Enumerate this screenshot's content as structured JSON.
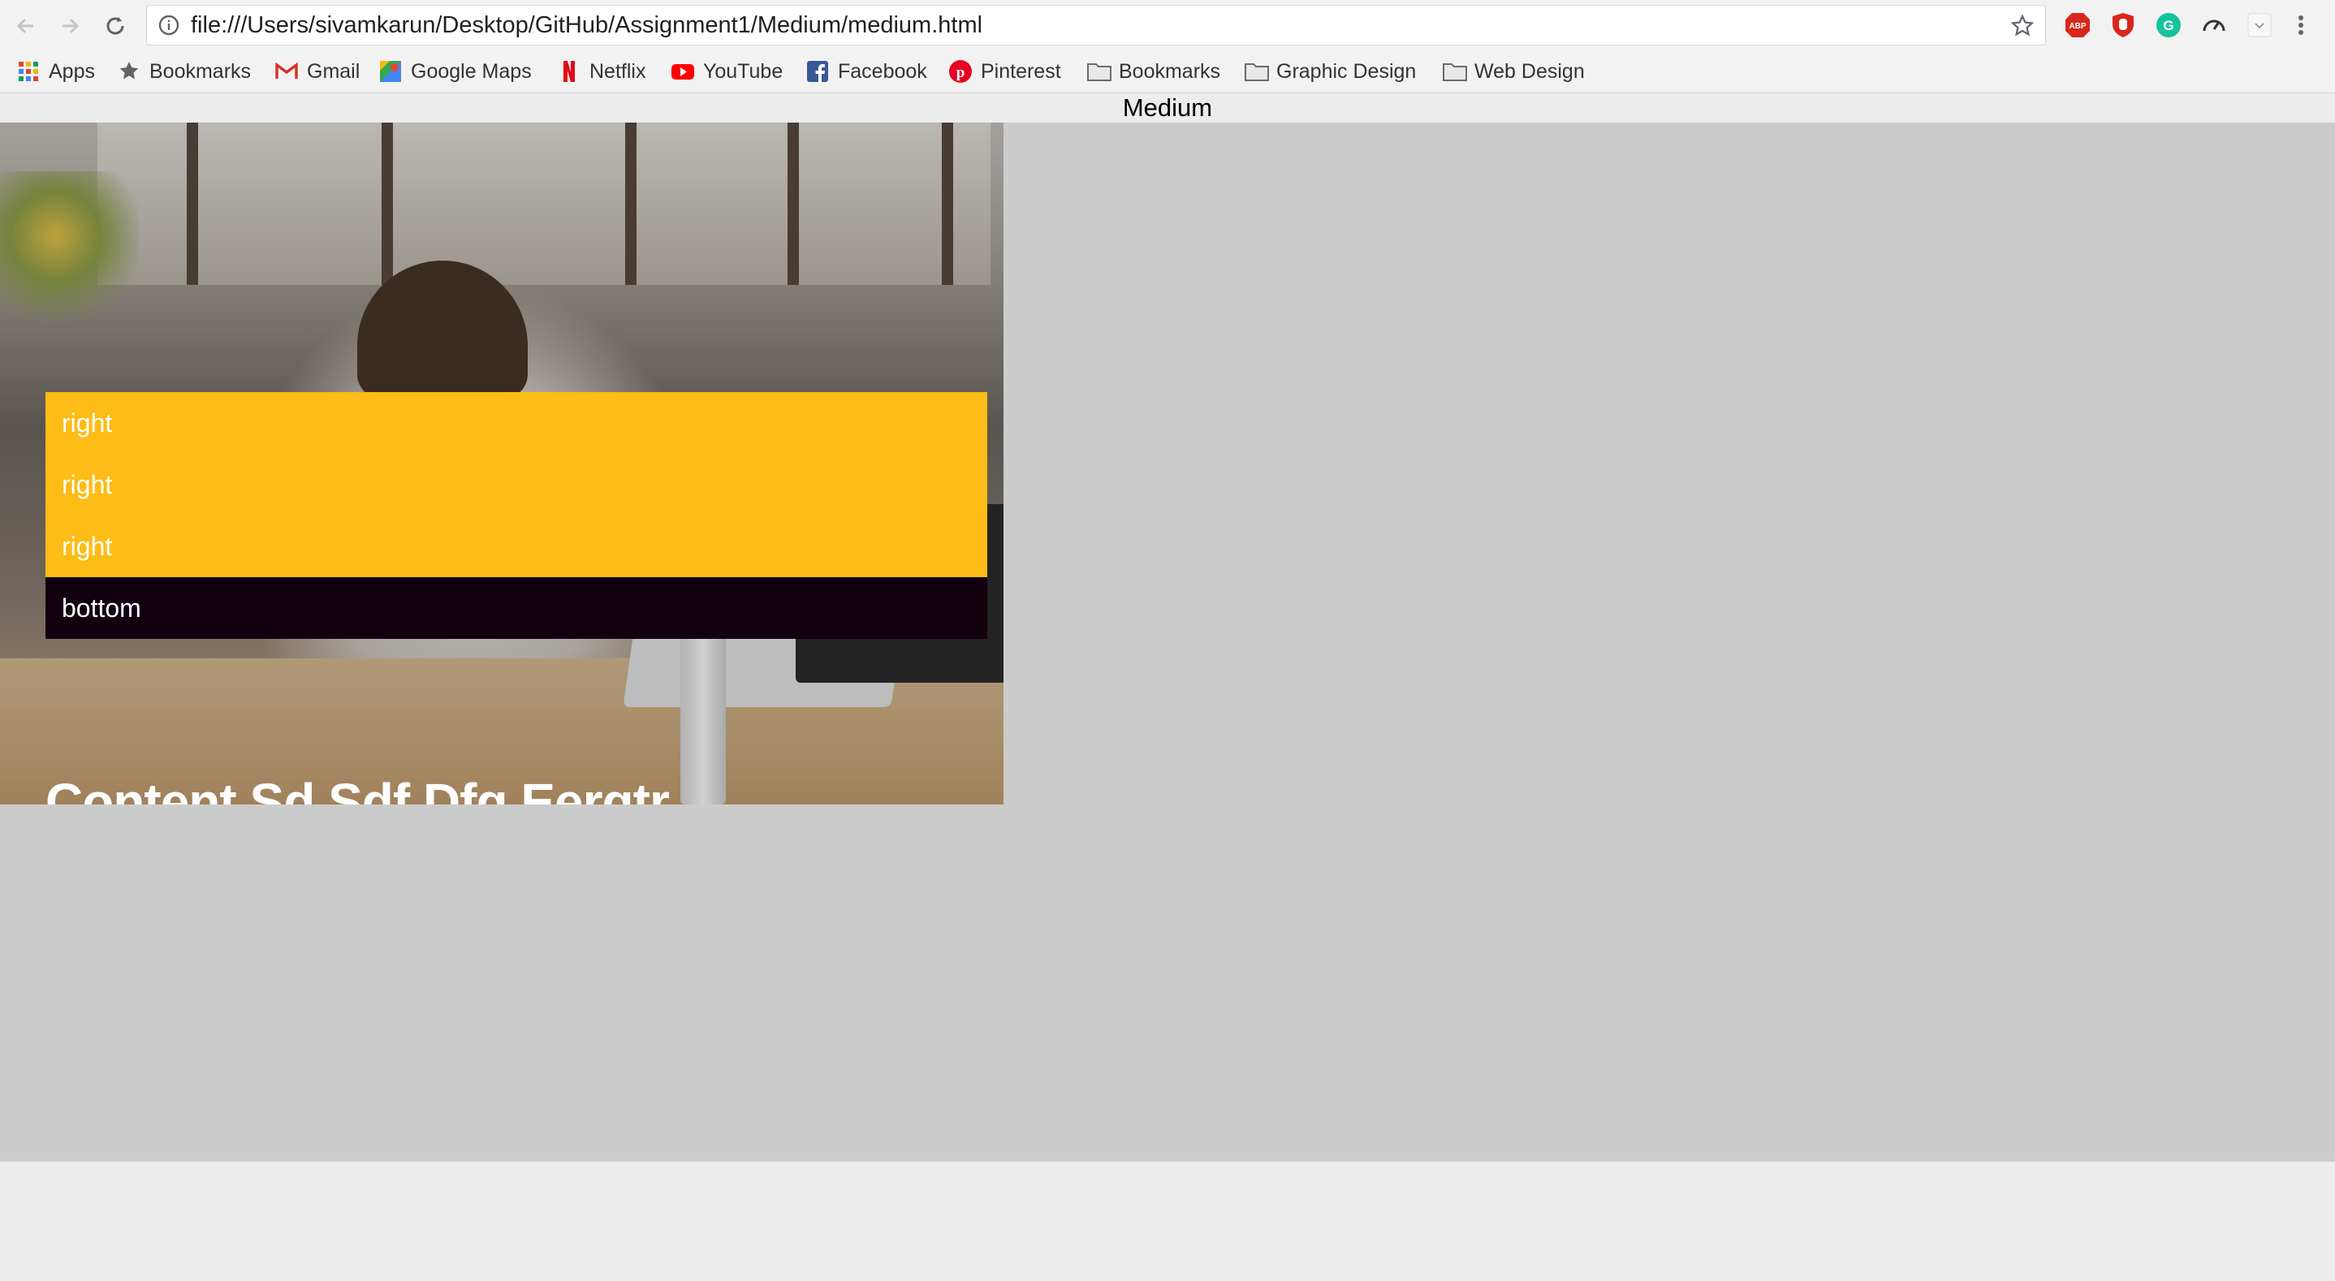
{
  "browser": {
    "url": "file:///Users/sivamkarun/Desktop/GitHub/Assignment1/Medium/medium.html",
    "extensions": [
      "abp-icon",
      "ublock-icon",
      "grammarly-icon",
      "speedometer-icon",
      "extension-icon"
    ],
    "bookmarks": [
      {
        "label": "Apps",
        "icon": "apps-grid-icon"
      },
      {
        "label": "Bookmarks",
        "icon": "star-icon"
      },
      {
        "label": "Gmail",
        "icon": "gmail-icon"
      },
      {
        "label": "Google Maps",
        "icon": "maps-icon"
      },
      {
        "label": "Netflix",
        "icon": "netflix-icon"
      },
      {
        "label": "YouTube",
        "icon": "youtube-icon"
      },
      {
        "label": "Facebook",
        "icon": "facebook-icon"
      },
      {
        "label": "Pinterest",
        "icon": "pinterest-icon"
      },
      {
        "label": "Bookmarks",
        "icon": "folder-icon"
      },
      {
        "label": "Graphic Design",
        "icon": "folder-icon"
      },
      {
        "label": "Web Design",
        "icon": "folder-icon"
      }
    ]
  },
  "page": {
    "header": "Medium",
    "menu": [
      {
        "label": "right",
        "kind": "right"
      },
      {
        "label": "right",
        "kind": "right"
      },
      {
        "label": "right",
        "kind": "right"
      },
      {
        "label": "bottom",
        "kind": "bottom"
      }
    ],
    "hero_title": "Content Sd Sdf Dfg Eergtr"
  },
  "colors": {
    "menu_right": "#fdbc16",
    "menu_bottom": "#12000e",
    "page_background": "#cccccc",
    "chrome_background": "#f2f2f2"
  }
}
